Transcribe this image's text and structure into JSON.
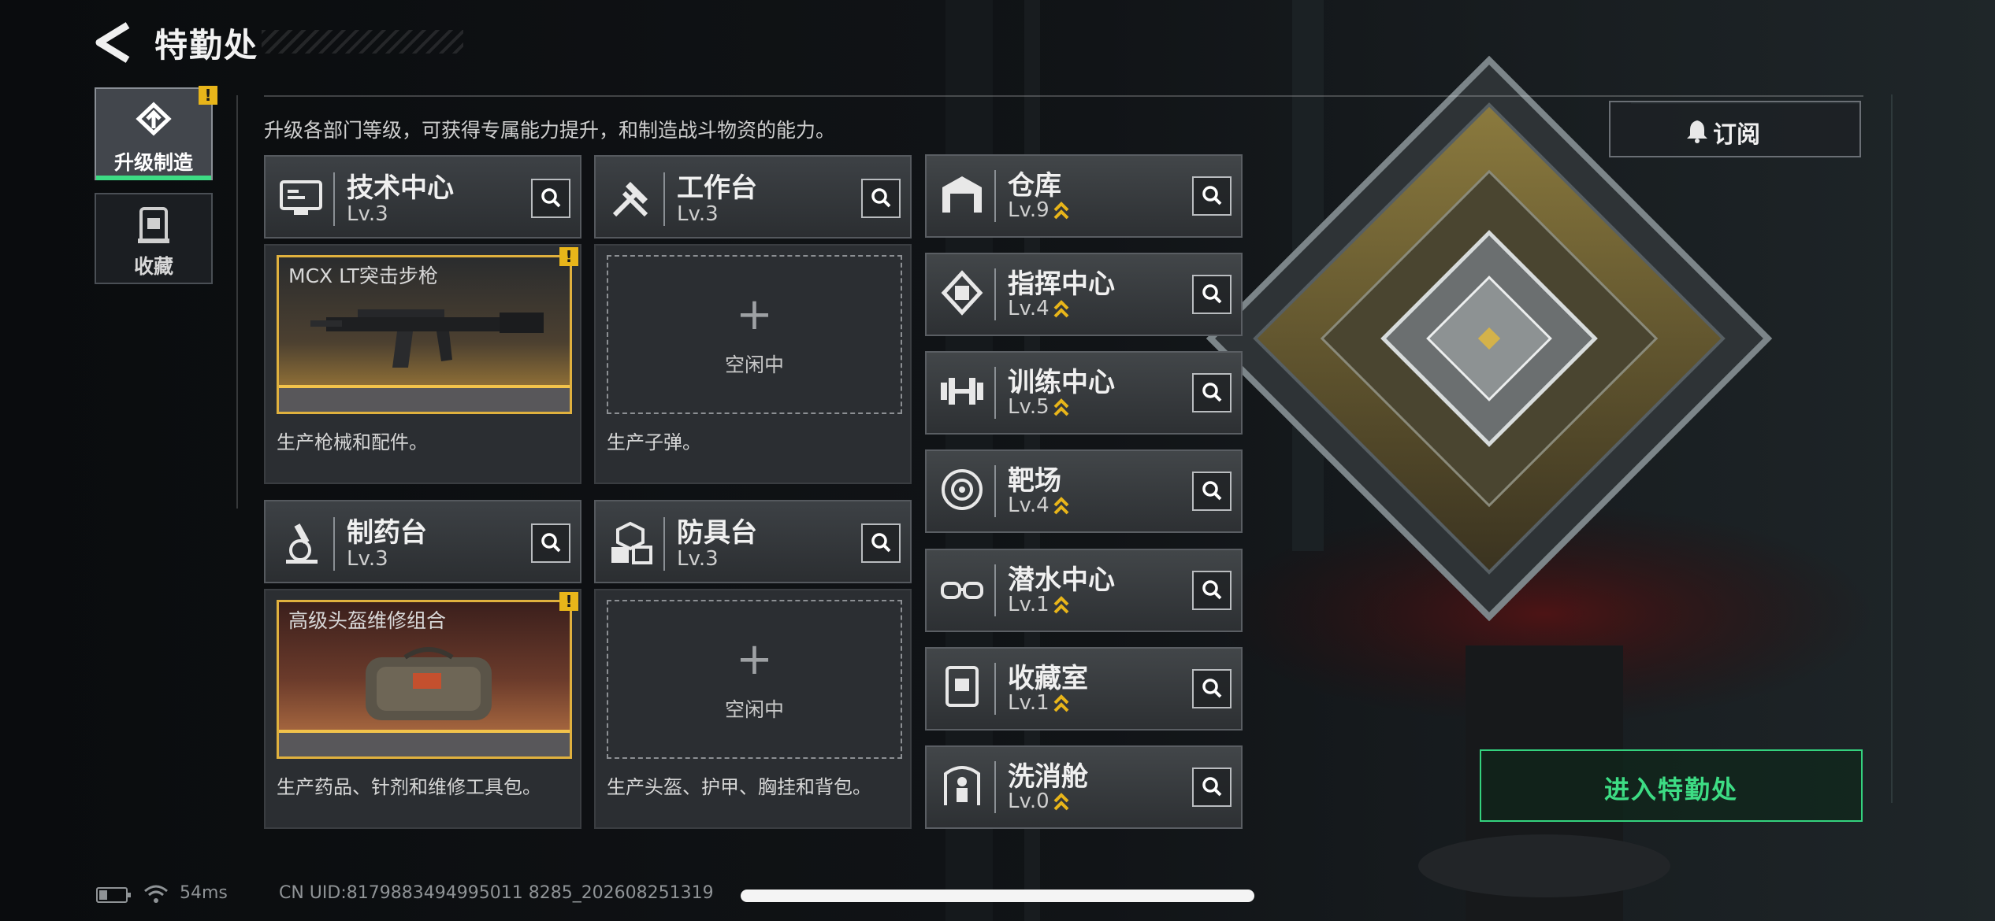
{
  "header": {
    "title": "特勤处"
  },
  "nav": [
    {
      "label": "升级制造",
      "active": true,
      "badge": "!"
    },
    {
      "label": "收藏",
      "active": false
    }
  ],
  "description": "升级各部门等级，可获得专属能力提升，和制造战斗物资的能力。",
  "subscribe_label": "订阅",
  "enter_label": "进入特勤处",
  "idle_label": "空闲中",
  "stations": [
    {
      "name": "技术中心",
      "level": "Lv.3",
      "icon": "monitor-icon",
      "product": "MCX LT突击步枪",
      "badge": "!",
      "description": "生产枪械和配件。"
    },
    {
      "name": "工作台",
      "level": "Lv.3",
      "icon": "tools-icon",
      "product": null,
      "description": "生产子弹。"
    },
    {
      "name": "制药台",
      "level": "Lv.3",
      "icon": "microscope-icon",
      "product": "高级头盔维修组合",
      "badge": "!",
      "description": "生产药品、针剂和维修工具包。"
    },
    {
      "name": "防具台",
      "level": "Lv.3",
      "icon": "armor-icon",
      "product": null,
      "description": "生产头盔、护甲、胸挂和背包。"
    }
  ],
  "departments": [
    {
      "name": "仓库",
      "level": "Lv.9",
      "icon": "warehouse-icon"
    },
    {
      "name": "指挥中心",
      "level": "Lv.4",
      "icon": "chip-icon"
    },
    {
      "name": "训练中心",
      "level": "Lv.5",
      "icon": "dumbbell-icon"
    },
    {
      "name": "靶场",
      "level": "Lv.4",
      "icon": "target-icon"
    },
    {
      "name": "潜水中心",
      "level": "Lv.1",
      "icon": "goggles-icon"
    },
    {
      "name": "收藏室",
      "level": "Lv.1",
      "icon": "display-case-icon"
    },
    {
      "name": "洗消舱",
      "level": "Lv.0",
      "icon": "decon-icon"
    }
  ],
  "status": {
    "ping": "54ms",
    "uid": "CN UID:8179883494995011 8285_202608251319"
  },
  "colors": {
    "accent_green": "#3ddc84",
    "upgrade_gold": "#e8b51a"
  }
}
